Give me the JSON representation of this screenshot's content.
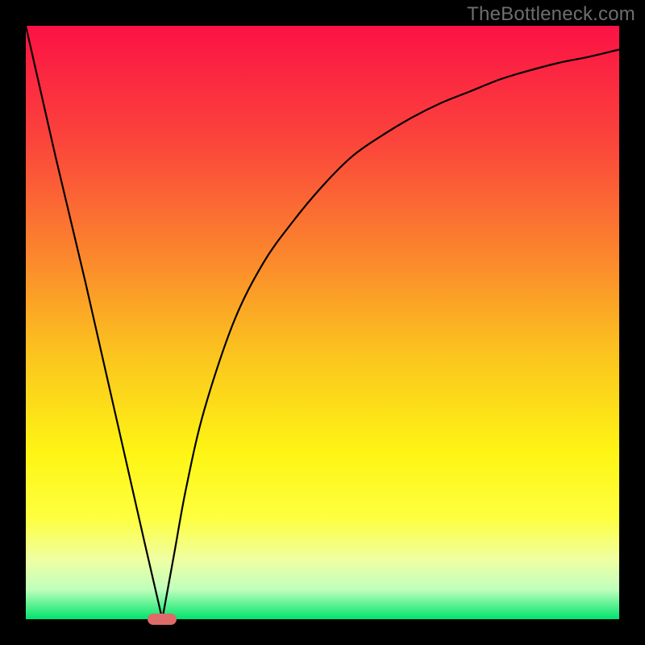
{
  "watermark": "TheBottleneck.com",
  "colors": {
    "frame": "#000000",
    "gradient_stops": [
      {
        "offset": 0.0,
        "color": "#fb1245"
      },
      {
        "offset": 0.2,
        "color": "#fb463b"
      },
      {
        "offset": 0.4,
        "color": "#fb8b2c"
      },
      {
        "offset": 0.55,
        "color": "#fbc31f"
      },
      {
        "offset": 0.72,
        "color": "#fef514"
      },
      {
        "offset": 0.83,
        "color": "#feff40"
      },
      {
        "offset": 0.9,
        "color": "#efffa3"
      },
      {
        "offset": 0.95,
        "color": "#bfffbc"
      },
      {
        "offset": 1.0,
        "color": "#00e46c"
      }
    ],
    "curve": "#000000",
    "marker": "#dd6b6a"
  },
  "chart_data": {
    "type": "line",
    "title": "",
    "xlabel": "",
    "ylabel": "",
    "xlim": [
      0,
      100
    ],
    "ylim": [
      0,
      100
    ],
    "notch_x": 23,
    "series": [
      {
        "name": "curve",
        "x": [
          0,
          5,
          10,
          15,
          20,
          23,
          25,
          27,
          30,
          35,
          40,
          45,
          50,
          55,
          60,
          65,
          70,
          75,
          80,
          85,
          90,
          95,
          100
        ],
        "values": [
          100,
          78,
          57,
          35,
          13,
          0,
          11,
          22,
          35,
          50,
          60,
          67,
          73,
          78,
          81.5,
          84.5,
          87,
          89,
          91,
          92.5,
          93.8,
          94.8,
          96
        ]
      }
    ],
    "marker": {
      "x": 23,
      "y": 0
    }
  }
}
